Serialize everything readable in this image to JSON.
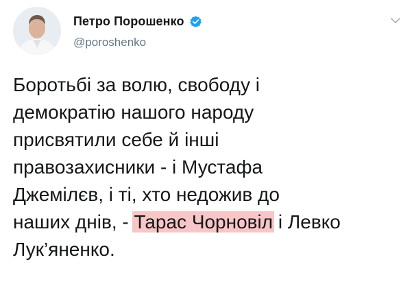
{
  "tweet": {
    "author": {
      "display_name": "Петро Порошенко",
      "handle": "@poroshenko",
      "verified": true
    },
    "icons": {
      "avatar": "profile-photo",
      "verified": "verified-badge-icon",
      "menu": "chevron-down-icon"
    },
    "colors": {
      "verified_blue": "#1da1f2",
      "highlight": "#f8c6c6",
      "handle_gray": "#657786"
    },
    "text_lines": {
      "l1": "Боротьбі за волю, свободу і",
      "l2": "демократію нашого народу",
      "l3": "присвятили себе й інші",
      "l4": "правозахисники - і Мустафа",
      "l5": "Джемілєв, і ті, хто недожив до",
      "l6_a": "наших днів, - ",
      "l6_highlight": "Тарас Чорновіл",
      "l6_b": " і Левко",
      "l7": "Лук’яненко."
    }
  }
}
